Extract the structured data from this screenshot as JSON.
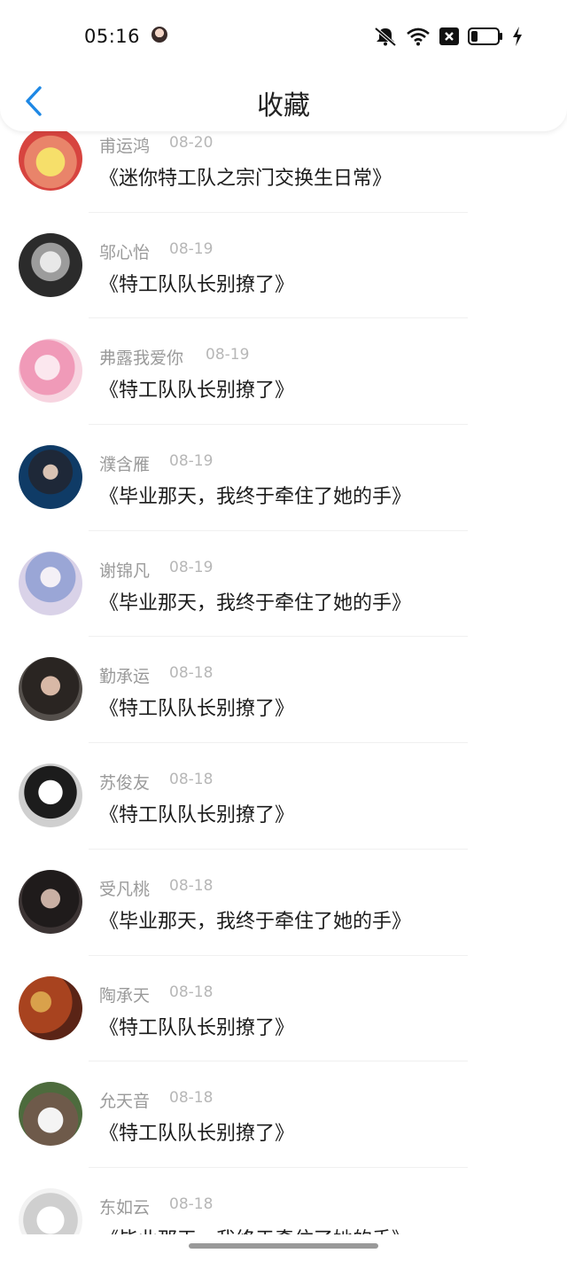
{
  "status_bar": {
    "time": "05:16",
    "icons": [
      "avatar-icon",
      "mute-icon",
      "wifi-icon",
      "close-box-icon",
      "battery-icon",
      "charging-icon"
    ]
  },
  "nav": {
    "back_icon": "chevron-left-icon",
    "title": "收藏"
  },
  "colors": {
    "accent": "#1e88e5",
    "name_text": "#9a9a9a",
    "date_text": "#b7b7b7",
    "title_text": "#1b1b1b"
  },
  "items": [
    {
      "user": "甫运鸿",
      "date": "08-20",
      "book": "《迷你特工队之宗门交换生日常》"
    },
    {
      "user": "邬心怡",
      "date": "08-19",
      "book": "《特工队队长别撩了》"
    },
    {
      "user": "弗露我爱你",
      "date": "08-19",
      "book": "《特工队队长别撩了》"
    },
    {
      "user": "濮含雁",
      "date": "08-19",
      "book": "《毕业那天，我终于牵住了她的手》"
    },
    {
      "user": "谢锦凡",
      "date": "08-19",
      "book": "《毕业那天，我终于牵住了她的手》"
    },
    {
      "user": "勤承运",
      "date": "08-18",
      "book": "《特工队队长别撩了》"
    },
    {
      "user": "苏俊友",
      "date": "08-18",
      "book": "《特工队队长别撩了》"
    },
    {
      "user": "受凡桃",
      "date": "08-18",
      "book": "《毕业那天，我终于牵住了她的手》"
    },
    {
      "user": "陶承天",
      "date": "08-18",
      "book": "《特工队队长别撩了》"
    },
    {
      "user": "允天音",
      "date": "08-18",
      "book": "《特工队队长别撩了》"
    },
    {
      "user": "东如云",
      "date": "08-18",
      "book": "《毕业那天，我终于牵住了她的手》"
    }
  ]
}
